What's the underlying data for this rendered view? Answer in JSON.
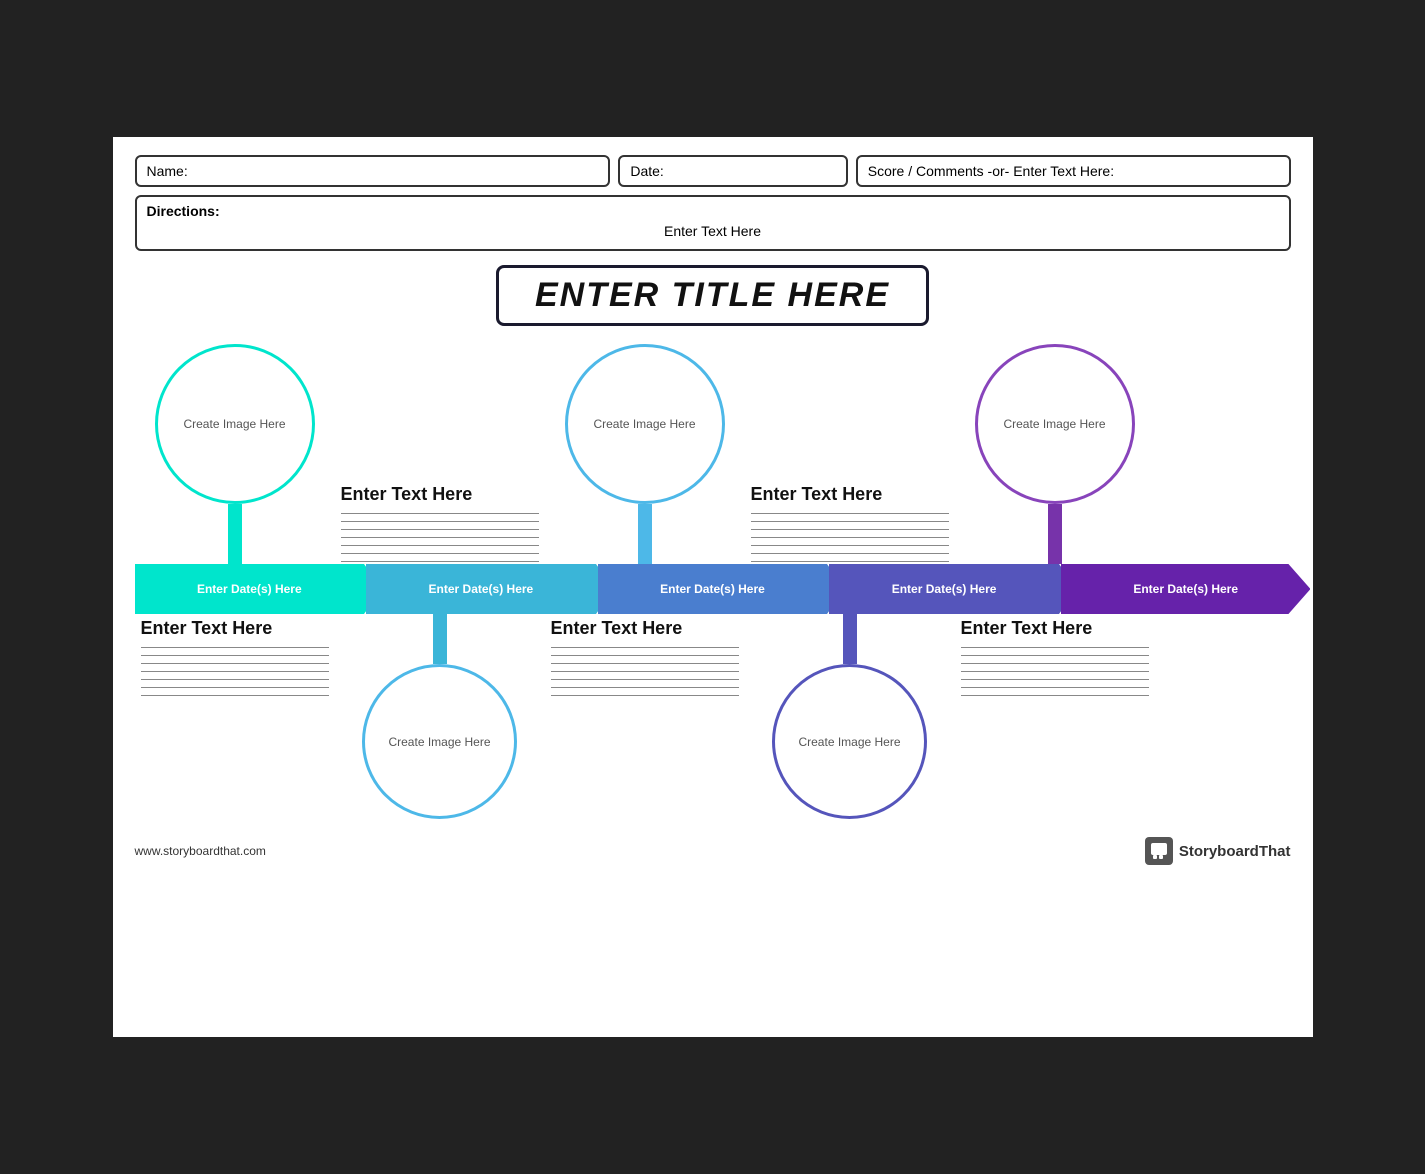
{
  "header": {
    "name_label": "Name:",
    "date_label": "Date:",
    "score_label": "Score / Comments -or- Enter Text Here:"
  },
  "directions": {
    "label": "Directions:",
    "text": "Enter Text Here"
  },
  "title": "ENTER TITLE HERE",
  "timeline": {
    "top_nodes": [
      {
        "id": 1,
        "circle_text": "Create Image Here",
        "color": "#00e5cc"
      },
      {
        "id": 2,
        "text_heading": "Enter Text Here",
        "lines": 7
      },
      {
        "id": 3,
        "circle_text": "Create Image Here",
        "color": "#4db8e8"
      },
      {
        "id": 4,
        "text_heading": "Enter Text Here",
        "lines": 7
      },
      {
        "id": 5,
        "circle_text": "Create Image Here",
        "color": "#8844bb"
      }
    ],
    "arrows": [
      {
        "id": 1,
        "label": "Enter Date(s) Here",
        "color": "#00e5cc"
      },
      {
        "id": 2,
        "label": "Enter Date(s) Here",
        "color": "#3ab5d8"
      },
      {
        "id": 3,
        "label": "Enter Date(s) Here",
        "color": "#4a7ecf"
      },
      {
        "id": 4,
        "label": "Enter Date(s) Here",
        "color": "#5555bb"
      },
      {
        "id": 5,
        "label": "Enter Date(s) Here",
        "color": "#6622aa"
      }
    ],
    "bottom_nodes": [
      {
        "id": 1,
        "text_heading": "Enter Text Here",
        "lines": 7
      },
      {
        "id": 2,
        "circle_text": "Create Image Here",
        "color": "#4db8e8"
      },
      {
        "id": 3,
        "text_heading": "Enter Text Here",
        "lines": 7
      },
      {
        "id": 4,
        "circle_text": "Create Image Here",
        "color": "#5555bb"
      },
      {
        "id": 5,
        "text_heading": "Enter Text Here",
        "lines": 7
      }
    ]
  },
  "footer": {
    "website": "www.storyboardthat.com",
    "brand": "StoryboardThat"
  }
}
